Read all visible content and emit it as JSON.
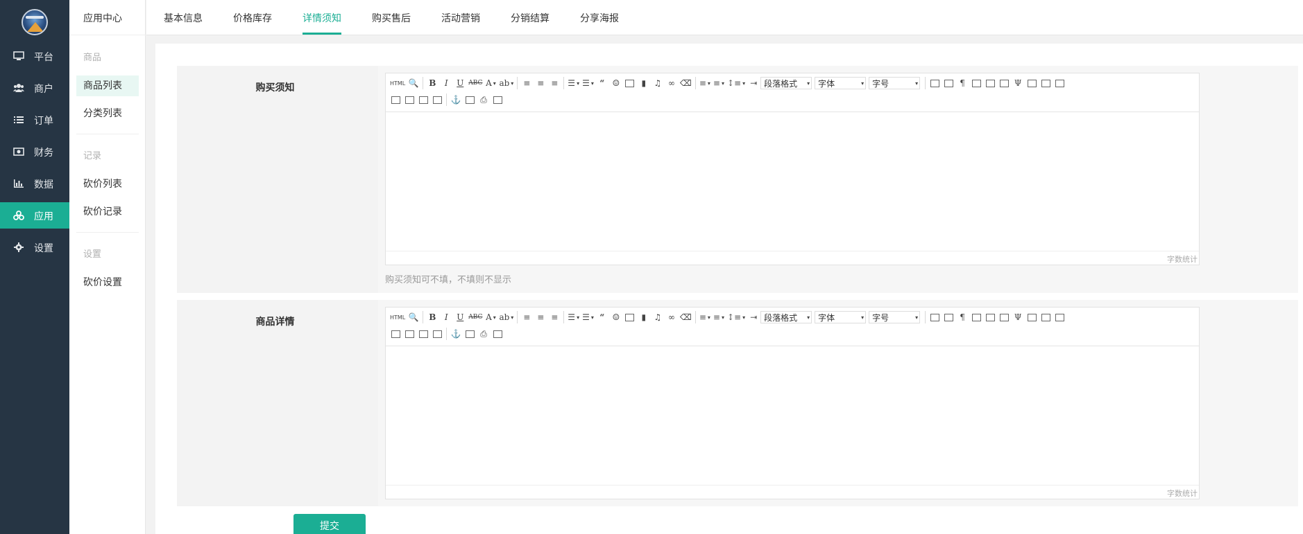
{
  "sidebar": {
    "items": [
      {
        "label": "平台",
        "icon": "monitor-icon"
      },
      {
        "label": "商户",
        "icon": "users-icon"
      },
      {
        "label": "订单",
        "icon": "list-icon"
      },
      {
        "label": "财务",
        "icon": "money-icon"
      },
      {
        "label": "数据",
        "icon": "bar-chart-icon"
      },
      {
        "label": "应用",
        "icon": "cubes-icon",
        "active": true
      },
      {
        "label": "设置",
        "icon": "gear-icon"
      }
    ],
    "active_color": "#1bae94",
    "bg_color": "#263544"
  },
  "submenu": {
    "title": "应用中心",
    "group1": "商品",
    "item1": "商品列表",
    "item2": "分类列表",
    "group2": "记录",
    "item3": "砍价列表",
    "item4": "砍价记录",
    "group3": "设置",
    "item5": "砍价设置"
  },
  "tabs": {
    "t1": "基本信息",
    "t2": "价格库存",
    "t3": "详情须知",
    "t4": "购买售后",
    "t5": "活动营销",
    "t6": "分销结算",
    "t7": "分享海报",
    "active": "详情须知"
  },
  "form": {
    "notice_label": "购买须知",
    "notice_hint": "购买须知可不填，不填则不显示",
    "detail_label": "商品详情",
    "word_count": "字数统计",
    "submit": "提交"
  },
  "editor": {
    "paragraph_format": "段落格式",
    "font_family": "字体",
    "font_size": "字号",
    "html_button": "HTML"
  }
}
